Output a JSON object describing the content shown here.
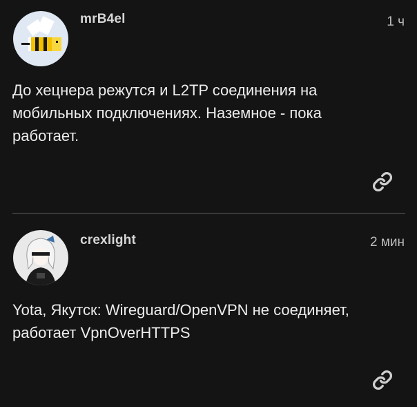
{
  "posts": [
    {
      "author": "mrB4el",
      "time": "1 ч",
      "avatar_icon": "bee-avatar",
      "lines": [
        "До хецнера режутся и L2TP соединения на",
        "мобильных подключениях. Наземное - пока",
        "работает."
      ],
      "action_icon": "link-icon"
    },
    {
      "author": "crexlight",
      "time": "2 мин",
      "avatar_icon": "anime-girl-avatar",
      "lines": [
        "Yota, Якутск: Wireguard/OpenVPN не соединяет,",
        "работает VpnOverHTTPS"
      ],
      "action_icon": "link-icon"
    }
  ],
  "colors": {
    "background": "#141414",
    "text": "#ececec",
    "divider": "#5a5a5a"
  }
}
